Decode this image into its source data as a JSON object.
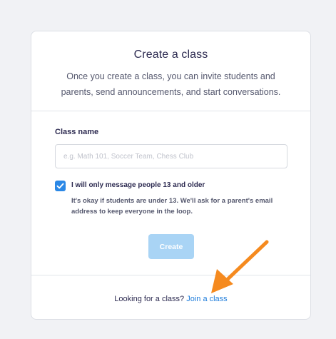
{
  "card": {
    "title": "Create a class",
    "subtitle": "Once you create a class, you can invite students and parents, send announcements, and start conversations."
  },
  "form": {
    "class_name_label": "Class name",
    "class_name_value": "",
    "class_name_placeholder": "e.g. Math 101, Soccer Team, Chess Club",
    "age_checkbox_checked": true,
    "age_checkbox_label": "I will only message people 13 and older",
    "age_checkbox_help": "It's okay if students are under 13. We'll ask for a parent's email address to keep everyone in the loop.",
    "create_button_label": "Create"
  },
  "footer": {
    "prompt_text": "Looking for a class?",
    "join_link_label": "Join a class"
  },
  "colors": {
    "accent": "#2b88e6",
    "link": "#1f7ddb",
    "create_button_disabled": "#a9d4f5",
    "annotation_arrow": "#f58a1f"
  },
  "icons": {
    "checkbox": "checkmark-icon",
    "annotation": "arrow-annotation-icon"
  }
}
